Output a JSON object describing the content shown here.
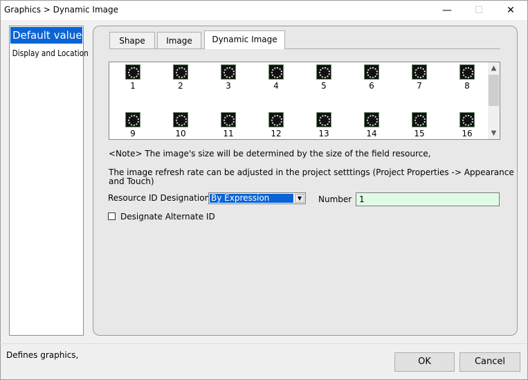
{
  "window": {
    "title": "Graphics > Dynamic Image",
    "minimize_glyph": "—",
    "maximize_glyph": "☐",
    "close_glyph": "✕"
  },
  "sidebar": {
    "items": [
      {
        "label": "Default value"
      },
      {
        "label": "Display and Location"
      }
    ]
  },
  "tabs": [
    {
      "label": "Shape"
    },
    {
      "label": "Image"
    },
    {
      "label": "Dynamic Image"
    }
  ],
  "gallery": {
    "items": [
      "1",
      "2",
      "3",
      "4",
      "5",
      "6",
      "7",
      "8",
      "9",
      "10",
      "11",
      "12",
      "13",
      "14",
      "15",
      "16"
    ],
    "scroll_up_glyph": "▲",
    "scroll_down_glyph": "▼"
  },
  "notes": {
    "note1": "<Note> The image's size will be determined by the size of the field resource,",
    "note2_line1": "The image refresh rate can be adjusted in the project setttings (Project Properties -> Appearance",
    "note2_line2": "and Touch)"
  },
  "form": {
    "resource_label": "Resource ID Designation",
    "resource_value": "By Expression",
    "dropdown_glyph": "▼",
    "number_label": "Number",
    "number_value": "1",
    "alternate_label": "Designate Alternate ID"
  },
  "footer": {
    "status": "Defines graphics,",
    "ok_label": "OK",
    "cancel_label": "Cancel"
  },
  "colors": {
    "selection": "#0a64d6",
    "number_field_bg": "#e0fae6"
  }
}
